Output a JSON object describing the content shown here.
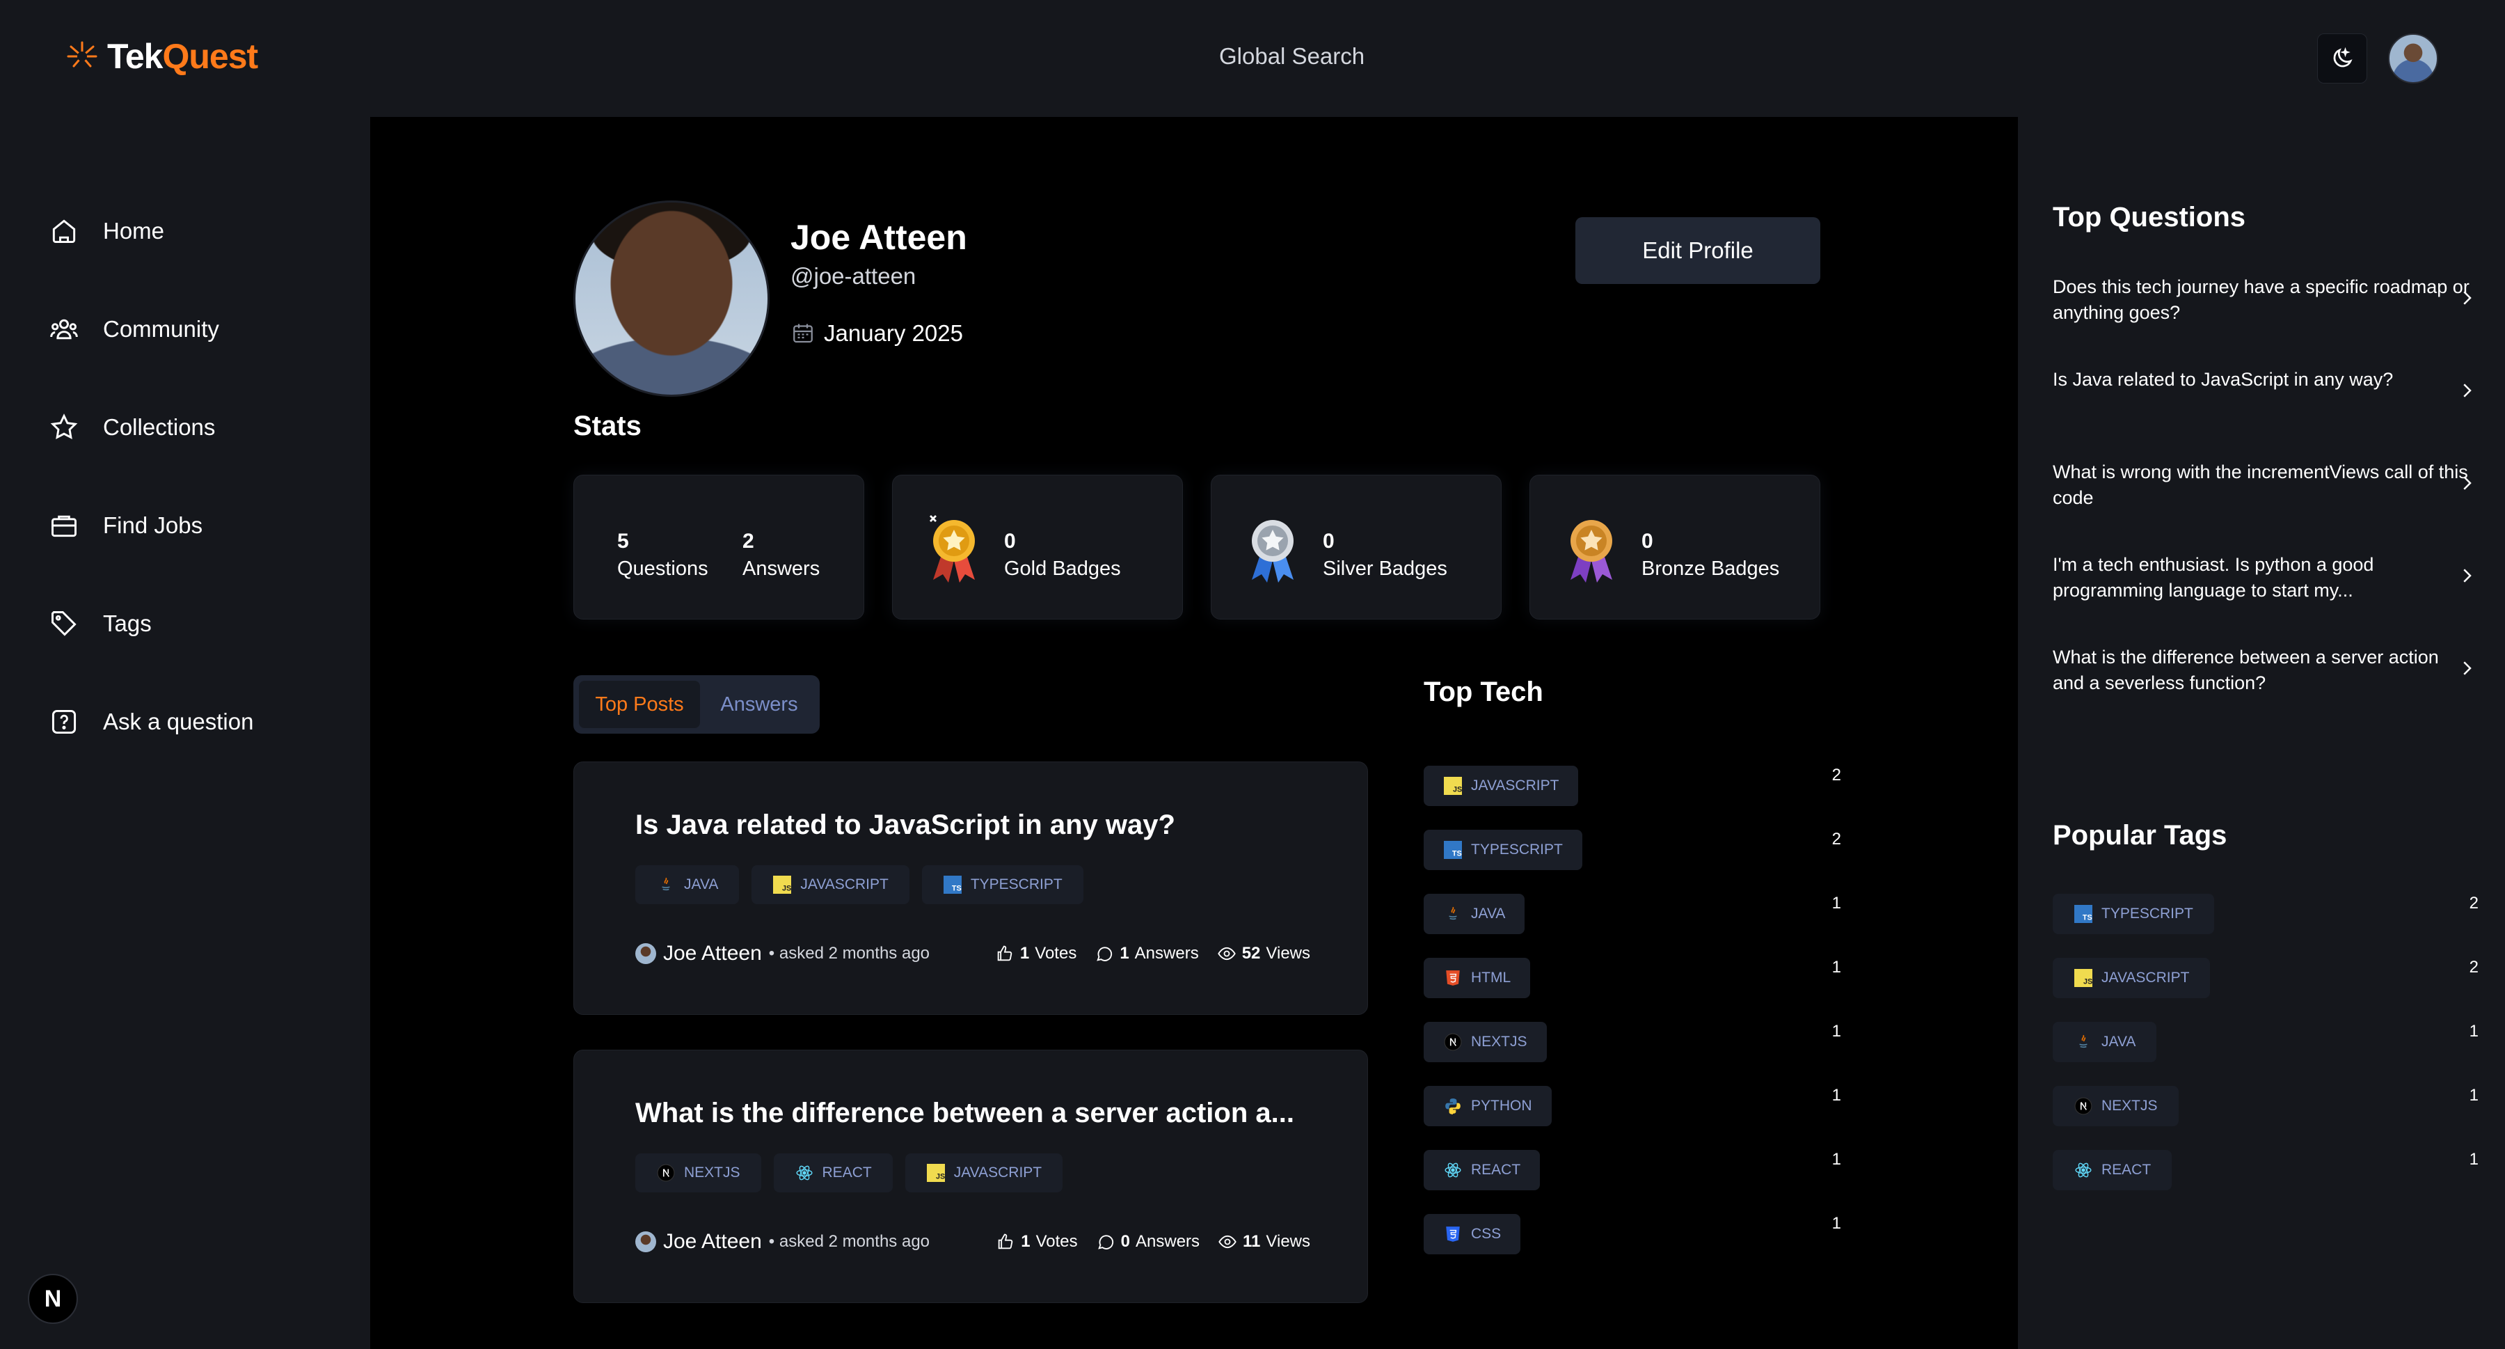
{
  "app": {
    "logo_prefix": "Tek",
    "logo_suffix": "Quest",
    "global_search": "Global Search"
  },
  "sidebar": {
    "items": [
      {
        "label": "Home",
        "icon": "home-icon"
      },
      {
        "label": "Community",
        "icon": "community-icon"
      },
      {
        "label": "Collections",
        "icon": "star-icon"
      },
      {
        "label": "Find Jobs",
        "icon": "briefcase-icon"
      },
      {
        "label": "Tags",
        "icon": "tag-icon"
      },
      {
        "label": "Ask a question",
        "icon": "question-icon"
      }
    ],
    "badge": "N"
  },
  "profile": {
    "name": "Joe Atteen",
    "handle": "@joe-atteen",
    "joined": "January 2025",
    "edit_button": "Edit Profile"
  },
  "stats": {
    "title": "Stats",
    "questions": {
      "value": "5",
      "label": "Questions"
    },
    "answers": {
      "value": "2",
      "label": "Answers"
    },
    "gold": {
      "value": "0",
      "label": "Gold Badges"
    },
    "silver": {
      "value": "0",
      "label": "Silver Badges"
    },
    "bronze": {
      "value": "0",
      "label": "Bronze Badges"
    }
  },
  "tabs": {
    "top_posts": "Top Posts",
    "answers": "Answers"
  },
  "posts": [
    {
      "title": "Is Java related to JavaScript in any way?",
      "tags": [
        "JAVA",
        "JAVASCRIPT",
        "TYPESCRIPT"
      ],
      "author": "Joe Atteen",
      "asked": "• asked 2 months ago",
      "votes": "1",
      "votes_label": "Votes",
      "answers": "1",
      "answers_label": "Answers",
      "views": "52",
      "views_label": "Views"
    },
    {
      "title": "What is the difference between a server action a...",
      "tags": [
        "NEXTJS",
        "REACT",
        "JAVASCRIPT"
      ],
      "author": "Joe Atteen",
      "asked": "• asked 2 months ago",
      "votes": "1",
      "votes_label": "Votes",
      "answers": "0",
      "answers_label": "Answers",
      "views": "11",
      "views_label": "Views"
    }
  ],
  "top_tech": {
    "title": "Top Tech",
    "items": [
      {
        "name": "JAVASCRIPT",
        "count": "2"
      },
      {
        "name": "TYPESCRIPT",
        "count": "2"
      },
      {
        "name": "JAVA",
        "count": "1"
      },
      {
        "name": "HTML",
        "count": "1"
      },
      {
        "name": "NEXTJS",
        "count": "1"
      },
      {
        "name": "PYTHON",
        "count": "1"
      },
      {
        "name": "REACT",
        "count": "1"
      },
      {
        "name": "CSS",
        "count": "1"
      }
    ]
  },
  "top_questions": {
    "title": "Top Questions",
    "items": [
      "Does this tech journey have a specific roadmap or anything goes?",
      "Is Java related to JavaScript in any way?",
      "What is wrong with the incrementViews call of this code",
      "I'm a tech enthusiast. Is python a good programming language to start my...",
      "What is the difference between a server action and a severless function?"
    ]
  },
  "popular_tags": {
    "title": "Popular Tags",
    "items": [
      {
        "name": "TYPESCRIPT",
        "count": "2"
      },
      {
        "name": "JAVASCRIPT",
        "count": "2"
      },
      {
        "name": "JAVA",
        "count": "1"
      },
      {
        "name": "NEXTJS",
        "count": "1"
      },
      {
        "name": "REACT",
        "count": "1"
      }
    ]
  },
  "colors": {
    "accent": "#ff7a1a",
    "tag_text": "#8ea0d4",
    "card_bg": "#15171c"
  }
}
